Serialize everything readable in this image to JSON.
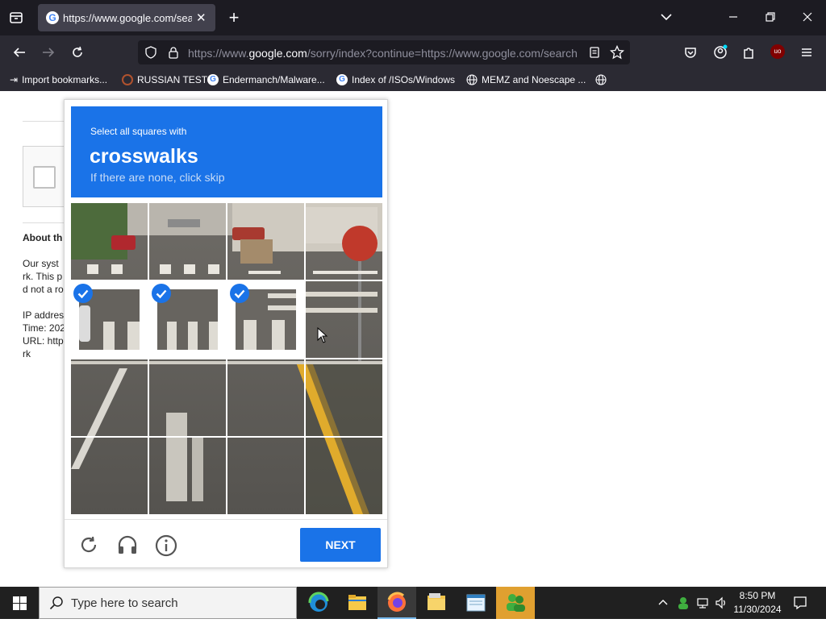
{
  "browser": {
    "tab_title": "https://www.google.com/search",
    "url_prefix": "https://www.",
    "url_domain": "google.com",
    "url_rest": "/sorry/index?continue=https://www.google.com/search",
    "bookmarks": [
      {
        "label": "Import bookmarks...",
        "icon": "import-icon"
      },
      {
        "label": "RUSSIAN TEST",
        "icon": "site-icon"
      },
      {
        "label": "Endermanch/Malware...",
        "icon": "google-icon"
      },
      {
        "label": "Index of /ISOs/Windows",
        "icon": "google-icon"
      },
      {
        "label": "MEMZ and Noescape ...",
        "icon": "globe-icon"
      }
    ],
    "toolbar_icons": [
      "back-icon",
      "forward-icon",
      "reload-icon",
      "shield-icon",
      "lock-icon",
      "reader-icon",
      "star-icon",
      "pocket-icon",
      "account-icon",
      "extensions-icon",
      "ublock-icon",
      "menu-icon"
    ],
    "ublock_badge": "uo"
  },
  "page": {
    "about_heading": "About th",
    "lines": [
      "Our syst",
      "rk. This p",
      "d not a ro"
    ],
    "meta_lines": [
      "IP addres",
      "Time: 202",
      "URL: http",
      "rk"
    ]
  },
  "captcha": {
    "instruction": "Select all squares with",
    "target": "crosswalks",
    "hint": "If there are none, click skip",
    "selected_tiles": [
      4,
      5,
      6
    ],
    "next_label": "NEXT",
    "footer_icons": [
      "reload-icon",
      "headphones-icon",
      "info-icon"
    ],
    "header_color": "#1a73e8"
  },
  "taskbar": {
    "search_placeholder": "Type here to search",
    "time": "8:50 PM",
    "date": "11/30/2024",
    "apps": [
      "edge-icon",
      "file-explorer-icon",
      "firefox-icon",
      "folder-icon",
      "notepad-icon",
      "users-icon"
    ]
  }
}
